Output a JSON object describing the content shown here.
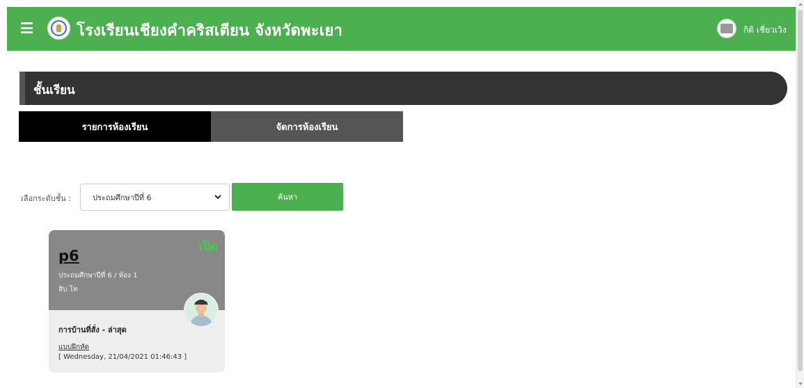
{
  "header": {
    "title": "โรงเรียนเชียงคำคริสเตียน จังหวัดพะเยา",
    "user_name": "กิติ เชี่ยวเวิง",
    "brand_color": "#4caf50"
  },
  "section": {
    "title": "ชั้นเรียน"
  },
  "tabs": [
    {
      "label": "รายการห้องเรียน",
      "active": true
    },
    {
      "label": "จัดการห้องเรียน",
      "active": false
    }
  ],
  "filter": {
    "label": "เลือกระดับชั้น :",
    "selected_value": "ประถมศึกษาปีที่ 6",
    "search_label": "ค้นหา"
  },
  "classroom_cards": [
    {
      "status": "เปิด",
      "code": "p6",
      "grade_room": "ประถมศึกษาปีที่ 6 / ห้อง 1",
      "teacher": "สิบ โท",
      "homework_title": "การบ้านที่สั่ง - ล่าสุด",
      "homework_name": "แบบฝึกหัด",
      "homework_date": "[ Wednesday, 21/04/2021 01:46:43 ]"
    }
  ],
  "icons": {
    "menu": "hamburger-menu-icon",
    "logo": "school-logo",
    "user": "user-avatar",
    "select_arrow": "chevron-down-icon"
  },
  "colors": {
    "header_green": "#4caf50",
    "section_dark": "#333333",
    "tab_active": "#000000",
    "tab_inactive": "#555555",
    "card_top": "#888888",
    "status_open": "#3bd23b"
  }
}
